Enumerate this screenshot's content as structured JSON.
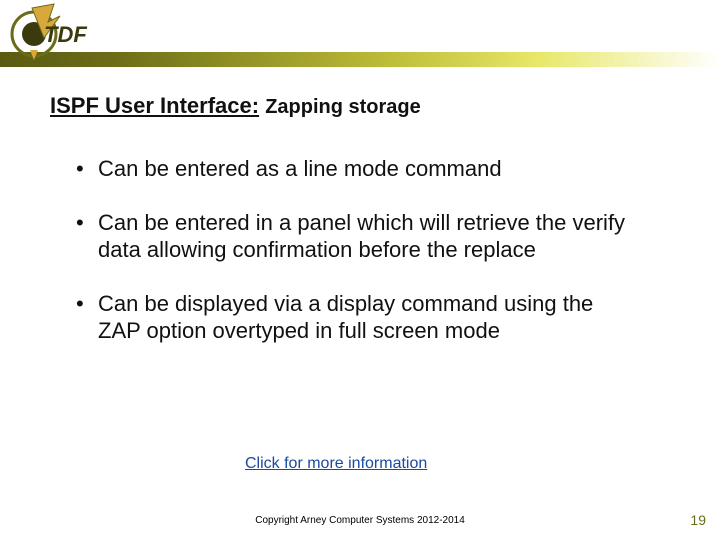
{
  "logo": {
    "name": "TDF"
  },
  "heading": {
    "main": "ISPF User Interface:",
    "sub": "Zapping storage"
  },
  "bullets": [
    "Can be entered as a line mode command",
    "Can be entered in a panel which will retrieve the verify data allowing confirmation before the replace",
    "Can be displayed via a display command using the ZAP option overtyped in full screen mode"
  ],
  "link": {
    "label": "Click for more information"
  },
  "footer": {
    "copyright": "Copyright Arney Computer Systems 2012-2014",
    "page": "19"
  },
  "colors": {
    "accent": "#6b6b18",
    "link": "#1a4aa0"
  }
}
